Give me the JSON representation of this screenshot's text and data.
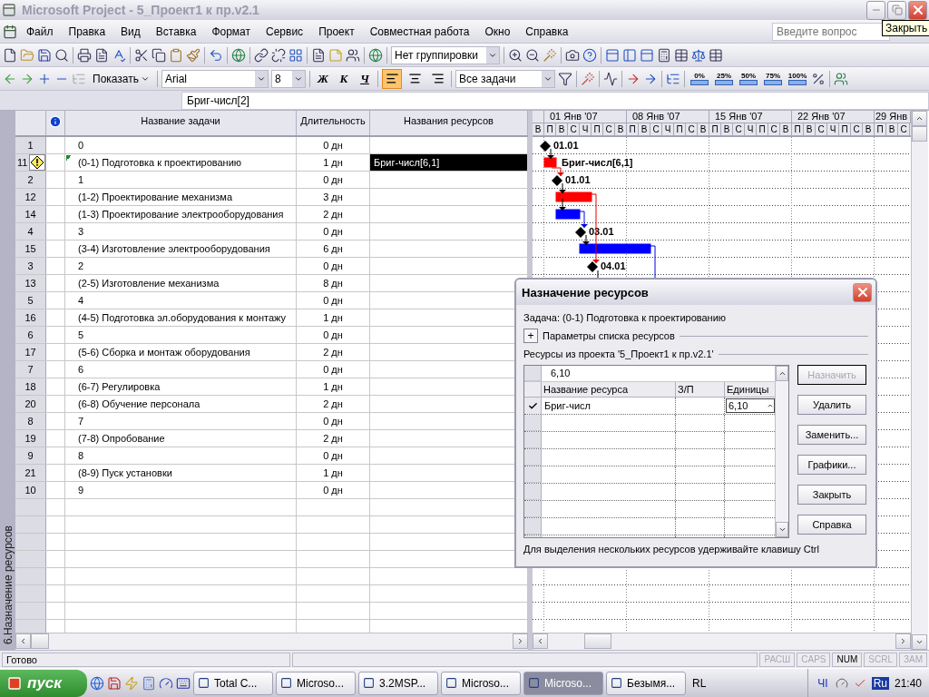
{
  "window": {
    "title": "Microsoft Project - 5_Проект1 к пр.v2.1",
    "tooltip": "Закрыть"
  },
  "menu": {
    "items": [
      "Файл",
      "Правка",
      "Вид",
      "Вставка",
      "Формат",
      "Сервис",
      "Проект",
      "Совместная работа",
      "Окно",
      "Справка"
    ],
    "help_placeholder": "Введите вопрос"
  },
  "toolbar": {
    "grouping": "Нет группировки",
    "show_button": "Показать",
    "font": "Arial",
    "size": "8",
    "format_buttons": [
      "Ж",
      "К",
      "Ч"
    ],
    "align_buttons": [
      {
        "selected": true
      },
      {
        "selected": false
      },
      {
        "selected": false
      }
    ],
    "filter": "Все задачи",
    "progress_buttons": [
      "0%",
      "25%",
      "50%",
      "75%",
      "100%"
    ]
  },
  "entry_bar": {
    "value": "Бриг-числ[2]"
  },
  "view_bar": {
    "label": "6.Назначение ресурсов"
  },
  "table": {
    "columns": [
      "Название задачи",
      "Длительность",
      "Названия ресурсов"
    ],
    "rows": [
      {
        "id": "1",
        "name": "0",
        "duration": "0 дн",
        "warning": false,
        "changed": false,
        "selected": false
      },
      {
        "id": "11",
        "name": "(0-1) Подготовка к проектированию",
        "duration": "1 дн",
        "resources": "Бриг-числ[6,1]",
        "warning": true,
        "changed": true,
        "selected": true
      },
      {
        "id": "2",
        "name": "1",
        "duration": "0 дн",
        "warning": false,
        "changed": false,
        "selected": false
      },
      {
        "id": "12",
        "name": "(1-2) Проектирование механизма",
        "duration": "3 дн",
        "warning": false,
        "changed": false,
        "selected": false
      },
      {
        "id": "14",
        "name": "(1-3) Проектирование электрооборудования",
        "duration": "2 дн",
        "warning": false,
        "changed": false,
        "selected": false
      },
      {
        "id": "4",
        "name": "3",
        "duration": "0 дн",
        "warning": false,
        "changed": false,
        "selected": false
      },
      {
        "id": "15",
        "name": "(3-4) Изготовление электрооборудования",
        "duration": "6 дн",
        "warning": false,
        "changed": false,
        "selected": false
      },
      {
        "id": "3",
        "name": "2",
        "duration": "0 дн",
        "warning": false,
        "changed": false,
        "selected": false
      },
      {
        "id": "13",
        "name": "(2-5) Изготовление механизма",
        "duration": "8 дн",
        "warning": false,
        "changed": false,
        "selected": false
      },
      {
        "id": "5",
        "name": "4",
        "duration": "0 дн",
        "warning": false,
        "changed": false,
        "selected": false
      },
      {
        "id": "16",
        "name": "(4-5) Подготовка эл.оборудования к монтажу",
        "duration": "1 дн",
        "warning": false,
        "changed": false,
        "selected": false
      },
      {
        "id": "6",
        "name": "5",
        "duration": "0 дн",
        "warning": false,
        "changed": false,
        "selected": false
      },
      {
        "id": "17",
        "name": "(5-6) Сборка и монтаж оборудования",
        "duration": "2 дн",
        "warning": false,
        "changed": false,
        "selected": false
      },
      {
        "id": "7",
        "name": "6",
        "duration": "0 дн",
        "warning": false,
        "changed": false,
        "selected": false
      },
      {
        "id": "18",
        "name": "(6-7) Регулировка",
        "duration": "1 дн",
        "warning": false,
        "changed": false,
        "selected": false
      },
      {
        "id": "20",
        "name": "(6-8) Обучение персонала",
        "duration": "2 дн",
        "warning": false,
        "changed": false,
        "selected": false
      },
      {
        "id": "8",
        "name": "7",
        "duration": "0 дн",
        "warning": false,
        "changed": false,
        "selected": false
      },
      {
        "id": "19",
        "name": "(7-8) Опробование",
        "duration": "2 дн",
        "warning": false,
        "changed": false,
        "selected": false
      },
      {
        "id": "9",
        "name": "8",
        "duration": "0 дн",
        "warning": false,
        "changed": false,
        "selected": false
      },
      {
        "id": "21",
        "name": "(8-9) Пуск установки",
        "duration": "1 дн",
        "warning": false,
        "changed": false,
        "selected": false
      },
      {
        "id": "10",
        "name": "9",
        "duration": "0 дн",
        "warning": false,
        "changed": false,
        "selected": false
      }
    ]
  },
  "gantt": {
    "weeks": [
      "01 Янв '07",
      "08 Янв '07",
      "15 Янв '07",
      "22 Янв '07",
      "29 Янв"
    ],
    "days": [
      "В",
      "П",
      "В",
      "С",
      "Ч",
      "П",
      "С",
      "В",
      "П",
      "В",
      "С",
      "Ч",
      "П",
      "С",
      "В",
      "П",
      "В",
      "С",
      "Ч",
      "П",
      "С",
      "В",
      "П",
      "В",
      "С",
      "Ч",
      "П",
      "С",
      "В",
      "П",
      "В",
      "С"
    ],
    "items": [
      {
        "kind": "milestone",
        "label": "01.01"
      },
      {
        "kind": "task",
        "color": "#ff0000",
        "label": "Бриг-числ[6,1]"
      },
      {
        "kind": "milestone",
        "label": "01.01"
      },
      {
        "kind": "task",
        "color": "#ff0000"
      },
      {
        "kind": "task",
        "color": "#0000ff"
      },
      {
        "kind": "milestone",
        "label": "03.01"
      },
      {
        "kind": "task",
        "color": "#0000ff"
      },
      {
        "kind": "milestone",
        "label": "04.01"
      }
    ]
  },
  "dialog": {
    "title": "Назначение ресурсов",
    "task": "Задача: (0-1) Подготовка к проектированию",
    "expander": "+",
    "options_label": "Параметры списка ресурсов",
    "resources_label": "Ресурсы из проекта '5_Проект1 к пр.v2.1'",
    "entry": "6,10",
    "columns": [
      "Название ресурса",
      "З/П",
      "Единицы"
    ],
    "resources": [
      {
        "name": "Бриг-числ",
        "units": "6,10",
        "assigned": true
      }
    ],
    "buttons": [
      {
        "label": "Назначить",
        "disabled": true
      },
      {
        "label": "Удалить",
        "disabled": false
      },
      {
        "label": "Заменить...",
        "disabled": false
      },
      {
        "label": "Графики...",
        "disabled": false
      },
      {
        "label": "Закрыть",
        "disabled": false
      },
      {
        "label": "Справка",
        "disabled": false
      }
    ],
    "hint": "Для выделения нескольких ресурсов удерживайте клавишу Ctrl"
  },
  "status_bar": {
    "text": "Готово",
    "indicators": [
      {
        "label": "РАСШ",
        "on": false
      },
      {
        "label": "CAPS",
        "on": false
      },
      {
        "label": "NUM",
        "on": true
      },
      {
        "label": "SCRL",
        "on": false
      },
      {
        "label": "ЗАМ",
        "on": false
      }
    ]
  },
  "taskbar": {
    "start": "пуск",
    "tasks": [
      {
        "label": "Total C...",
        "selected": false
      },
      {
        "label": "Microso...",
        "selected": false
      },
      {
        "label": "3.2MSP...",
        "selected": false
      },
      {
        "label": "Microso...",
        "selected": false
      },
      {
        "label": "Microso...",
        "selected": true
      },
      {
        "label": "Безымя...",
        "selected": false
      }
    ],
    "language_bar": "RL",
    "tray": [
      "ЧI",
      "Ru"
    ],
    "clock": "21:40"
  }
}
